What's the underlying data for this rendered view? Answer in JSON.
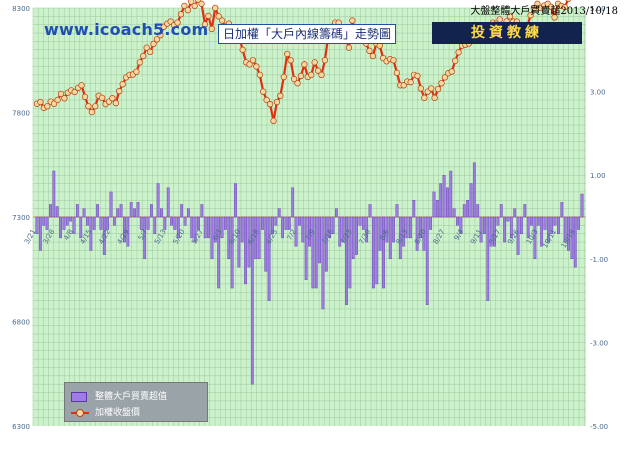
{
  "header": {
    "top_title": "大盤整體大戶買賣超2013/10/18",
    "logo": "www.icoach5.com",
    "chart_title": "日加權「大戶內線籌碼」走勢圖",
    "badge": "投資教練"
  },
  "colors": {
    "plot_bg": "#ccf2cc",
    "grid": "#9ec89e",
    "line": "#e03010",
    "marker_fill": "#f6d7a0",
    "bar_fill": "#a07be8",
    "bar_stroke": "#5a3aa0"
  },
  "chart_data": {
    "type": "bar+line",
    "title": "日加權「大戶內線籌碼」走勢圖",
    "left_axis": {
      "ylim": [
        6300,
        8300
      ],
      "ticks": [
        "8300",
        "7800",
        "7300",
        "6800",
        "6300"
      ]
    },
    "right_axis": {
      "ylim": [
        -5,
        5
      ],
      "ticks": [
        "5.00",
        "3.00",
        "1.00",
        "-1.00",
        "-3.00",
        "-5.00"
      ]
    },
    "x_ticks": [
      "3/21",
      "3/28",
      "4/8",
      "4/15",
      "4/22",
      "4/29",
      "5/7",
      "5/13",
      "5/20",
      "5/27",
      "6/3",
      "6/10",
      "6/18",
      "6/25",
      "7/2",
      "7/9",
      "7/16",
      "7/23",
      "7/30",
      "8/6",
      "8/13",
      "8/20",
      "8/27",
      "9/4",
      "9/11",
      "9/17",
      "9/26",
      "10/3",
      "10/11",
      "10/18"
    ],
    "grid": true,
    "legend_position": "bottom-left",
    "series": [
      {
        "name": "整體大戶買賣超值",
        "type": "bar",
        "axis": "right",
        "values": [
          -0.4,
          -0.8,
          -0.2,
          -0.3,
          0.3,
          1.1,
          0.25,
          -0.5,
          -0.3,
          -0.2,
          -0.1,
          -0.4,
          0.3,
          -0.5,
          0.2,
          -0.2,
          -0.8,
          -0.3,
          0.3,
          -0.3,
          -0.9,
          -0.3,
          0.6,
          -0.2,
          0.2,
          0.3,
          -0.6,
          -0.7,
          0.35,
          0.2,
          0.35,
          -0.3,
          -1.0,
          -0.3,
          0.3,
          -0.4,
          0.8,
          0.2,
          -0.3,
          0.7,
          -0.2,
          -0.3,
          -0.5,
          0.3,
          -0.2,
          0.2,
          -0.5,
          -0.6,
          -0.3,
          0.3,
          -0.5,
          -0.5,
          -1.0,
          -0.6,
          -1.7,
          -0.5,
          -0.3,
          -1.0,
          -1.7,
          0.8,
          -1.2,
          -0.6,
          -1.6,
          -1.2,
          -4.0,
          -1.0,
          -1.0,
          -0.3,
          -1.3,
          -2.0,
          -0.4,
          -0.2,
          0.2,
          -0.5,
          -0.3,
          -0.3,
          0.7,
          -0.7,
          -0.2,
          -0.6,
          -1.5,
          -0.7,
          -1.7,
          -1.7,
          -1.1,
          -2.2,
          -1.3,
          -0.5,
          -0.4,
          0.2,
          -0.7,
          -0.6,
          -2.1,
          -1.7,
          -1.0,
          -0.9,
          -0.2,
          -0.3,
          -0.6,
          0.3,
          -1.7,
          -1.6,
          -0.8,
          -1.7,
          -0.6,
          -1.0,
          -0.6,
          0.3,
          -1.0,
          -0.7,
          -0.5,
          -0.5,
          0.4,
          -0.8,
          -0.5,
          -0.8,
          -2.1,
          -0.3,
          0.6,
          0.4,
          0.8,
          1.0,
          0.7,
          1.1,
          0.2,
          -0.2,
          -0.4,
          0.3,
          0.4,
          0.8,
          1.3,
          0.3,
          -0.6,
          -0.4,
          -2.0,
          -0.7,
          -0.7,
          -0.2,
          0.3,
          -0.6,
          -0.1,
          -0.5,
          0.2,
          -0.9,
          -0.4,
          0.3,
          -0.5,
          -0.2,
          -1.0,
          -0.2,
          -0.7,
          -0.3,
          -0.6,
          -0.4,
          -0.2,
          -0.4,
          0.35,
          -0.6,
          -0.8,
          -1.0,
          -1.2,
          -0.3,
          0.55
        ]
      },
      {
        "name": "加權收盤價",
        "type": "line",
        "axis": "left",
        "values": [
          7842,
          7850,
          7822,
          7830,
          7852,
          7842,
          7860,
          7889,
          7868,
          7895,
          7906,
          7898,
          7918,
          7930,
          7875,
          7830,
          7802,
          7830,
          7880,
          7870,
          7840,
          7852,
          7868,
          7845,
          7902,
          7935,
          7968,
          7980,
          7982,
          7995,
          8040,
          8070,
          8110,
          8090,
          8128,
          8150,
          8170,
          8210,
          8225,
          8235,
          8218,
          8230,
          8270,
          8310,
          8290,
          8330,
          8310,
          8340,
          8320,
          8222,
          8262,
          8200,
          8300,
          8260,
          8240,
          8210,
          8225,
          8200,
          8150,
          8160,
          8100,
          8040,
          8030,
          8050,
          8020,
          7980,
          7900,
          7860,
          7840,
          7760,
          7850,
          7880,
          7970,
          8080,
          8050,
          7960,
          7940,
          7975,
          8030,
          7970,
          7980,
          8040,
          8000,
          7980,
          8050,
          8170,
          8210,
          8230,
          8230,
          8190,
          8160,
          8110,
          8240,
          8180,
          8185,
          8150,
          8130,
          8095,
          8070,
          8130,
          8120,
          8060,
          8045,
          8055,
          8050,
          7990,
          7930,
          7930,
          7948,
          7945,
          7980,
          7975,
          7915,
          7870,
          7900,
          7915,
          7870,
          7912,
          7940,
          7968,
          7988,
          7996,
          8047,
          8088,
          8120,
          8124,
          8130,
          8158,
          8188,
          8193,
          8200,
          8205,
          8180,
          8230,
          8225,
          8245,
          8210,
          8236,
          8260,
          8235,
          8235,
          8194,
          8199,
          8210,
          8265,
          8300,
          8320,
          8300,
          8312,
          8320,
          8305,
          8255,
          8320,
          8310,
          8304,
          8344,
          8380,
          8410,
          8430,
          8463
        ]
      }
    ]
  }
}
